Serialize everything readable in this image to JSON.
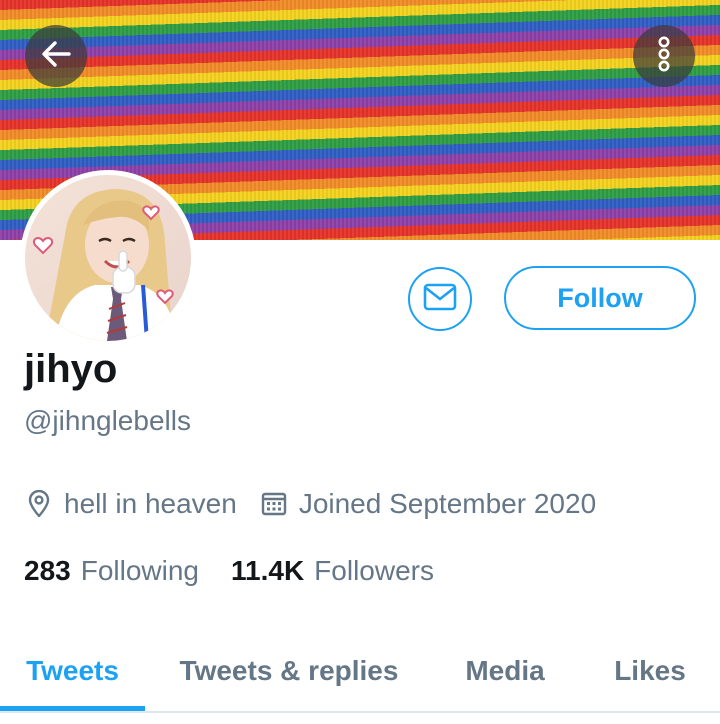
{
  "header": {
    "back_icon": "arrow-left-icon",
    "more_icon": "more-vertical-icon"
  },
  "profile": {
    "name": "jihyo",
    "handle": "@jihnglebells",
    "location": "hell in heaven",
    "location_icon": "location-pin-icon",
    "joined": "Joined September 2020",
    "joined_icon": "calendar-icon"
  },
  "actions": {
    "message_icon": "envelope-icon",
    "follow_label": "Follow"
  },
  "stats": {
    "following_count": "283",
    "following_label": "Following",
    "followers_count": "11.4K",
    "followers_label": "Followers"
  },
  "tabs": [
    {
      "label": "Tweets",
      "active": true
    },
    {
      "label": "Tweets & replies",
      "active": false
    },
    {
      "label": "Media",
      "active": false
    },
    {
      "label": "Likes",
      "active": false
    }
  ],
  "colors": {
    "accent": "#1da1f2",
    "text_primary": "#14171a",
    "text_secondary": "#657786"
  }
}
